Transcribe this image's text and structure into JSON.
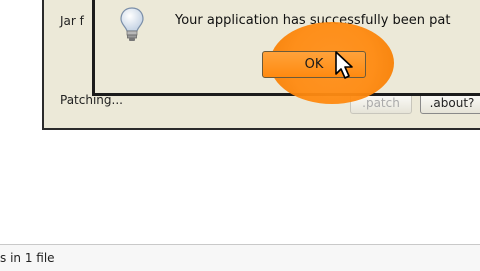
{
  "patcher": {
    "jar_label": "Jar f",
    "status_label": "Patching...",
    "patch_button": ".patch",
    "about_button": ".about?"
  },
  "dialog": {
    "message": "Your application has successfully been pat",
    "ok_button": "OK",
    "icon": "lightbulb-icon"
  },
  "status_bar": {
    "text": "s in 1 file"
  },
  "colors": {
    "highlight": "#ff8a10",
    "window_bg": "#ece9d8"
  }
}
